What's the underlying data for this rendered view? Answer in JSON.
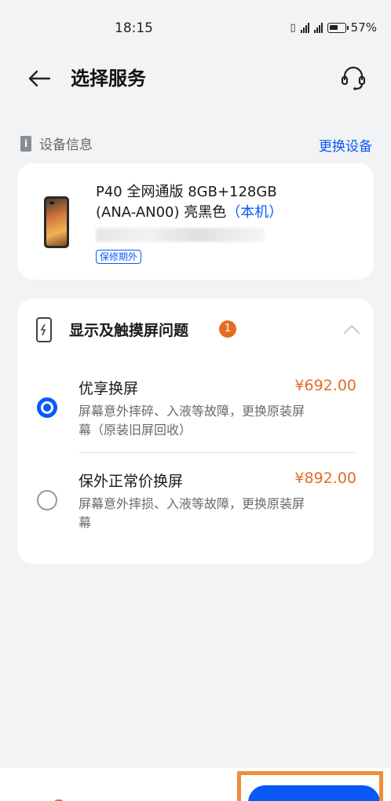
{
  "status_bar": {
    "time": "18:15",
    "battery": "57%"
  },
  "header": {
    "title": "选择服务",
    "back_icon": "arrow-left-icon",
    "support_icon": "headset-icon"
  },
  "device_section": {
    "label": "设备信息",
    "change_link": "更换设备",
    "device": {
      "name_line1": "P40 全网通版 8GB+128GB",
      "name_line2": "(ANA-AN00) 亮黑色",
      "local_tag": "（本机）",
      "warranty": "保修期外"
    }
  },
  "service_section": {
    "title": "显示及触摸屏问题",
    "count": "1",
    "options": [
      {
        "name": "优享换屏",
        "price": "¥692.00",
        "desc": "屏幕意外摔碎、入液等故障，更换原装屏幕（原装旧屏回收）",
        "selected": true
      },
      {
        "name": "保外正常价换屏",
        "price": "¥892.00",
        "desc": "屏幕意外摔损、入液等故障，更换原装屏幕",
        "selected": false
      }
    ]
  },
  "colors": {
    "accent": "#0a59f7",
    "price": "#e66b23",
    "highlight": "#f08c3a",
    "background": "#f1f3f5"
  }
}
